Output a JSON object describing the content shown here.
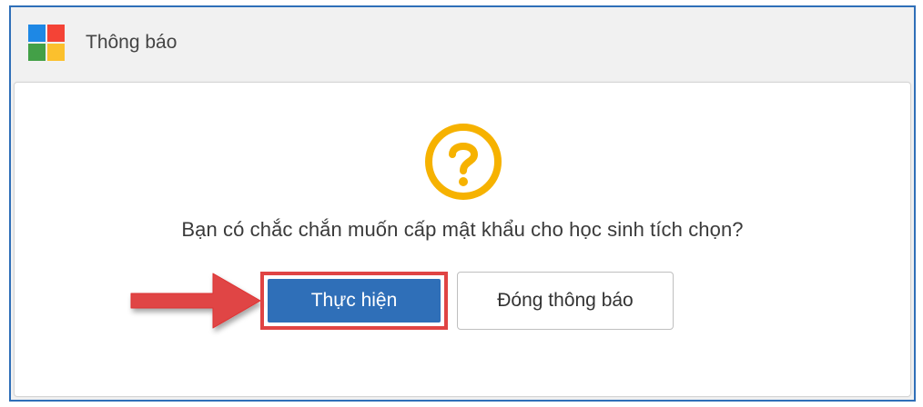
{
  "window": {
    "title": "Thông báo",
    "icon": "windows-logo-icon"
  },
  "dialog": {
    "icon": "question-mark-icon",
    "message": "Bạn có chắc chắn muốn cấp mật khẩu cho học sinh tích chọn?",
    "primary_button": "Thực hiện",
    "secondary_button": "Đóng thông báo"
  },
  "annotation": {
    "icon": "red-arrow-icon"
  },
  "colors": {
    "accent": "#2f6fb8",
    "warning": "#f6b200",
    "highlight": "#e04444"
  }
}
